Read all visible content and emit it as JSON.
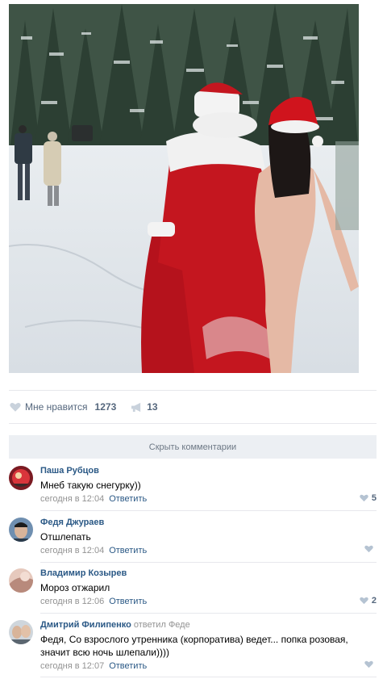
{
  "post": {
    "like_label": "Мне нравится",
    "like_count": "1273",
    "share_count": "13"
  },
  "comments_toggle": "Скрыть комментарии",
  "comments": [
    {
      "author": "Паша Рубцов",
      "text": "Мнеб такую снегурку))",
      "time": "сегодня в 12:04",
      "reply": "Ответить",
      "likes": "5"
    },
    {
      "author": "Федя Джураев",
      "text": "Отшлепать",
      "time": "сегодня в 12:04",
      "reply": "Ответить",
      "likes": ""
    },
    {
      "author": "Владимир Козырев",
      "text": "Мороз отжарил",
      "time": "сегодня в 12:06",
      "reply": "Ответить",
      "likes": "2"
    },
    {
      "author": "Дмитрий Филипенко",
      "replied_word": "ответил",
      "replied_to": "Феде",
      "text": "Федя, Со взрослого утренника (корпоратива) ведет... попка розовая, значит всю ночь шлепали))))",
      "time": "сегодня в 12:07",
      "reply": "Ответить",
      "likes": ""
    }
  ],
  "colors": {
    "link": "#2a5885",
    "meta": "#939393",
    "action": "#55677d",
    "divider": "#e7e8ec"
  }
}
